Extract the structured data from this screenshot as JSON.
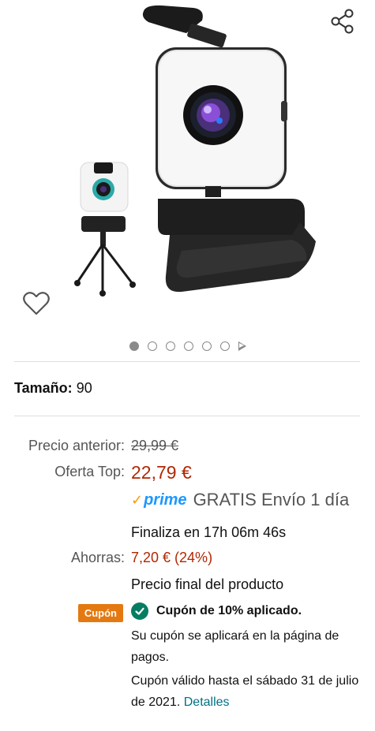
{
  "size": {
    "label": "Tamaño:",
    "value": "90"
  },
  "gallery": {
    "image_count": 6,
    "active_index": 0,
    "has_video": true,
    "product_image_alt": "Webcam con anillo de luz y trípode"
  },
  "pricing": {
    "previous_label": "Precio anterior:",
    "previous_price": "29,99 €",
    "deal_label": "Oferta Top:",
    "deal_price": "22,79 €",
    "prime_logo": "prime",
    "shipping_text": "GRATIS Envío 1 día",
    "countdown_text": "Finaliza en 17h 06m 46s",
    "savings_label": "Ahorras:",
    "savings_value": "7,20 € (24%)",
    "final_price_text": "Precio final del producto"
  },
  "coupon": {
    "badge": "Cupón",
    "applied_text": "Cupón de 10% aplicado.",
    "note": "Su cupón se aplicará en la página de pagos.",
    "valid_text": "Cupón válido hasta el sábado 31 de julio de 2021.",
    "details_link": "Detalles"
  },
  "colors": {
    "deal_red": "#b12704",
    "prime_blue": "#1a98ff",
    "coupon_orange": "#e47911",
    "check_green": "#067d62",
    "link_teal": "#007185"
  },
  "icons": [
    "share-icon",
    "heart-icon",
    "check-icon",
    "play-icon"
  ]
}
